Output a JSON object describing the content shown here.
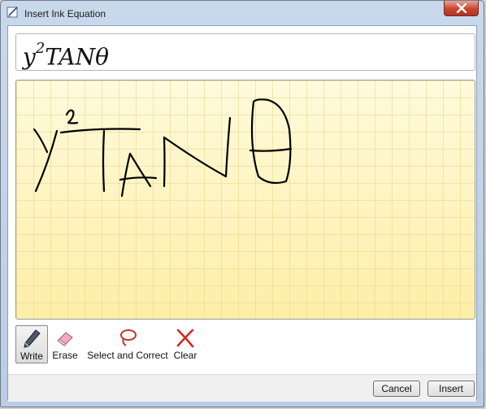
{
  "window": {
    "title": "Insert Ink Equation",
    "icon": "ink-equation-icon"
  },
  "preview": {
    "base": "y",
    "exponent": "2",
    "rest": "TANθ"
  },
  "tools": [
    {
      "label": "Write",
      "icon": "pen-icon",
      "active": true
    },
    {
      "label": "Erase",
      "icon": "eraser-icon",
      "active": false
    },
    {
      "label": "Select and Correct",
      "icon": "lasso-icon",
      "active": false
    },
    {
      "label": "Clear",
      "icon": "clear-x-icon",
      "active": false
    }
  ],
  "buttons": {
    "cancel": "Cancel",
    "insert": "Insert"
  },
  "colors": {
    "ink": "#000000",
    "canvas": "#fff4bd",
    "close": "#c8442f"
  }
}
